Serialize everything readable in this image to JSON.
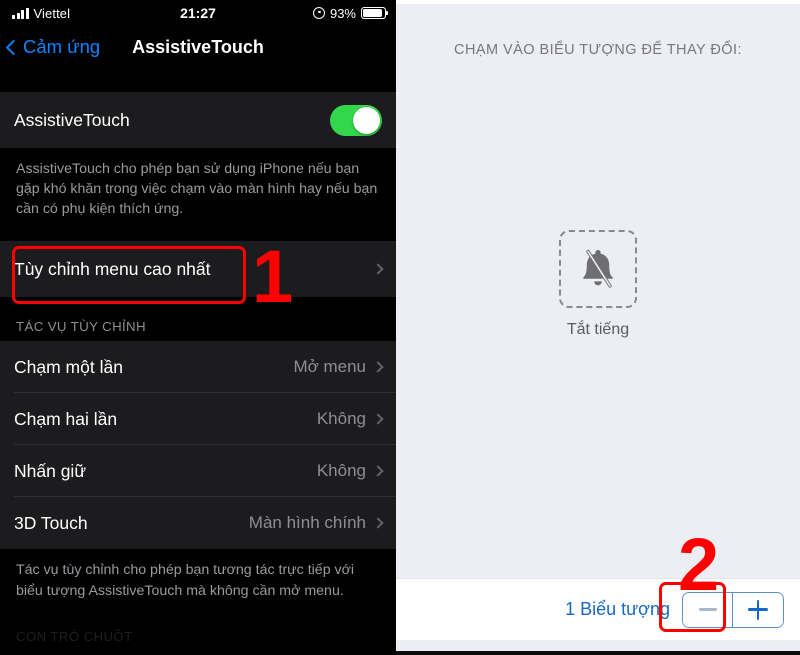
{
  "left": {
    "status_bar": {
      "carrier": "Viettel",
      "signal_icon": "signal-bars-icon",
      "time": "21:27",
      "alarm_icon": "alarm-clock-icon",
      "battery_percent": "93%",
      "battery_icon": "battery-icon"
    },
    "nav": {
      "back_icon": "chevron-left-icon",
      "back_label": "Cảm ứng",
      "title": "AssistiveTouch"
    },
    "toggle_row": {
      "label": "AssistiveTouch",
      "switch_on": true,
      "switch_color": "#32d74b"
    },
    "toggle_footnote": "AssistiveTouch cho phép bạn sử dụng iPhone nếu bạn gặp khó khăn trong việc chạm vào màn hình hay nếu bạn cần có phụ kiện thích ứng.",
    "customize_row": {
      "label": "Tùy chỉnh menu cao nhất",
      "chevron_icon": "chevron-right-icon"
    },
    "section_header": "TÁC VỤ TÙY CHỈNH",
    "action_rows": [
      {
        "label": "Chạm một lần",
        "value": "Mở menu",
        "chevron_icon": "chevron-right-icon"
      },
      {
        "label": "Chạm hai lần",
        "value": "Không",
        "chevron_icon": "chevron-right-icon"
      },
      {
        "label": "Nhấn giữ",
        "value": "Không",
        "chevron_icon": "chevron-right-icon"
      },
      {
        "label": "3D Touch",
        "value": "Màn hình chính",
        "chevron_icon": "chevron-right-icon"
      }
    ],
    "actions_footnote": "Tác vụ tùy chỉnh cho phép bạn tương tác trực tiếp với biểu tượng AssistiveTouch mà không cần mở menu.",
    "cut_section_header": "CON TRỎ CHUỘT"
  },
  "right": {
    "header": "CHẠM VÀO BIỂU TƯỢNG ĐỂ THAY ĐỔI:",
    "icon_tile": {
      "icon": "bell-slash-icon",
      "label": "Tắt tiếng"
    },
    "bottom_bar": {
      "count_label": "1 Biểu tượng",
      "minus_icon": "minus-icon",
      "plus_icon": "plus-icon"
    }
  },
  "annotations": {
    "step1": "1",
    "step2": "2",
    "color": "#ff0000"
  }
}
